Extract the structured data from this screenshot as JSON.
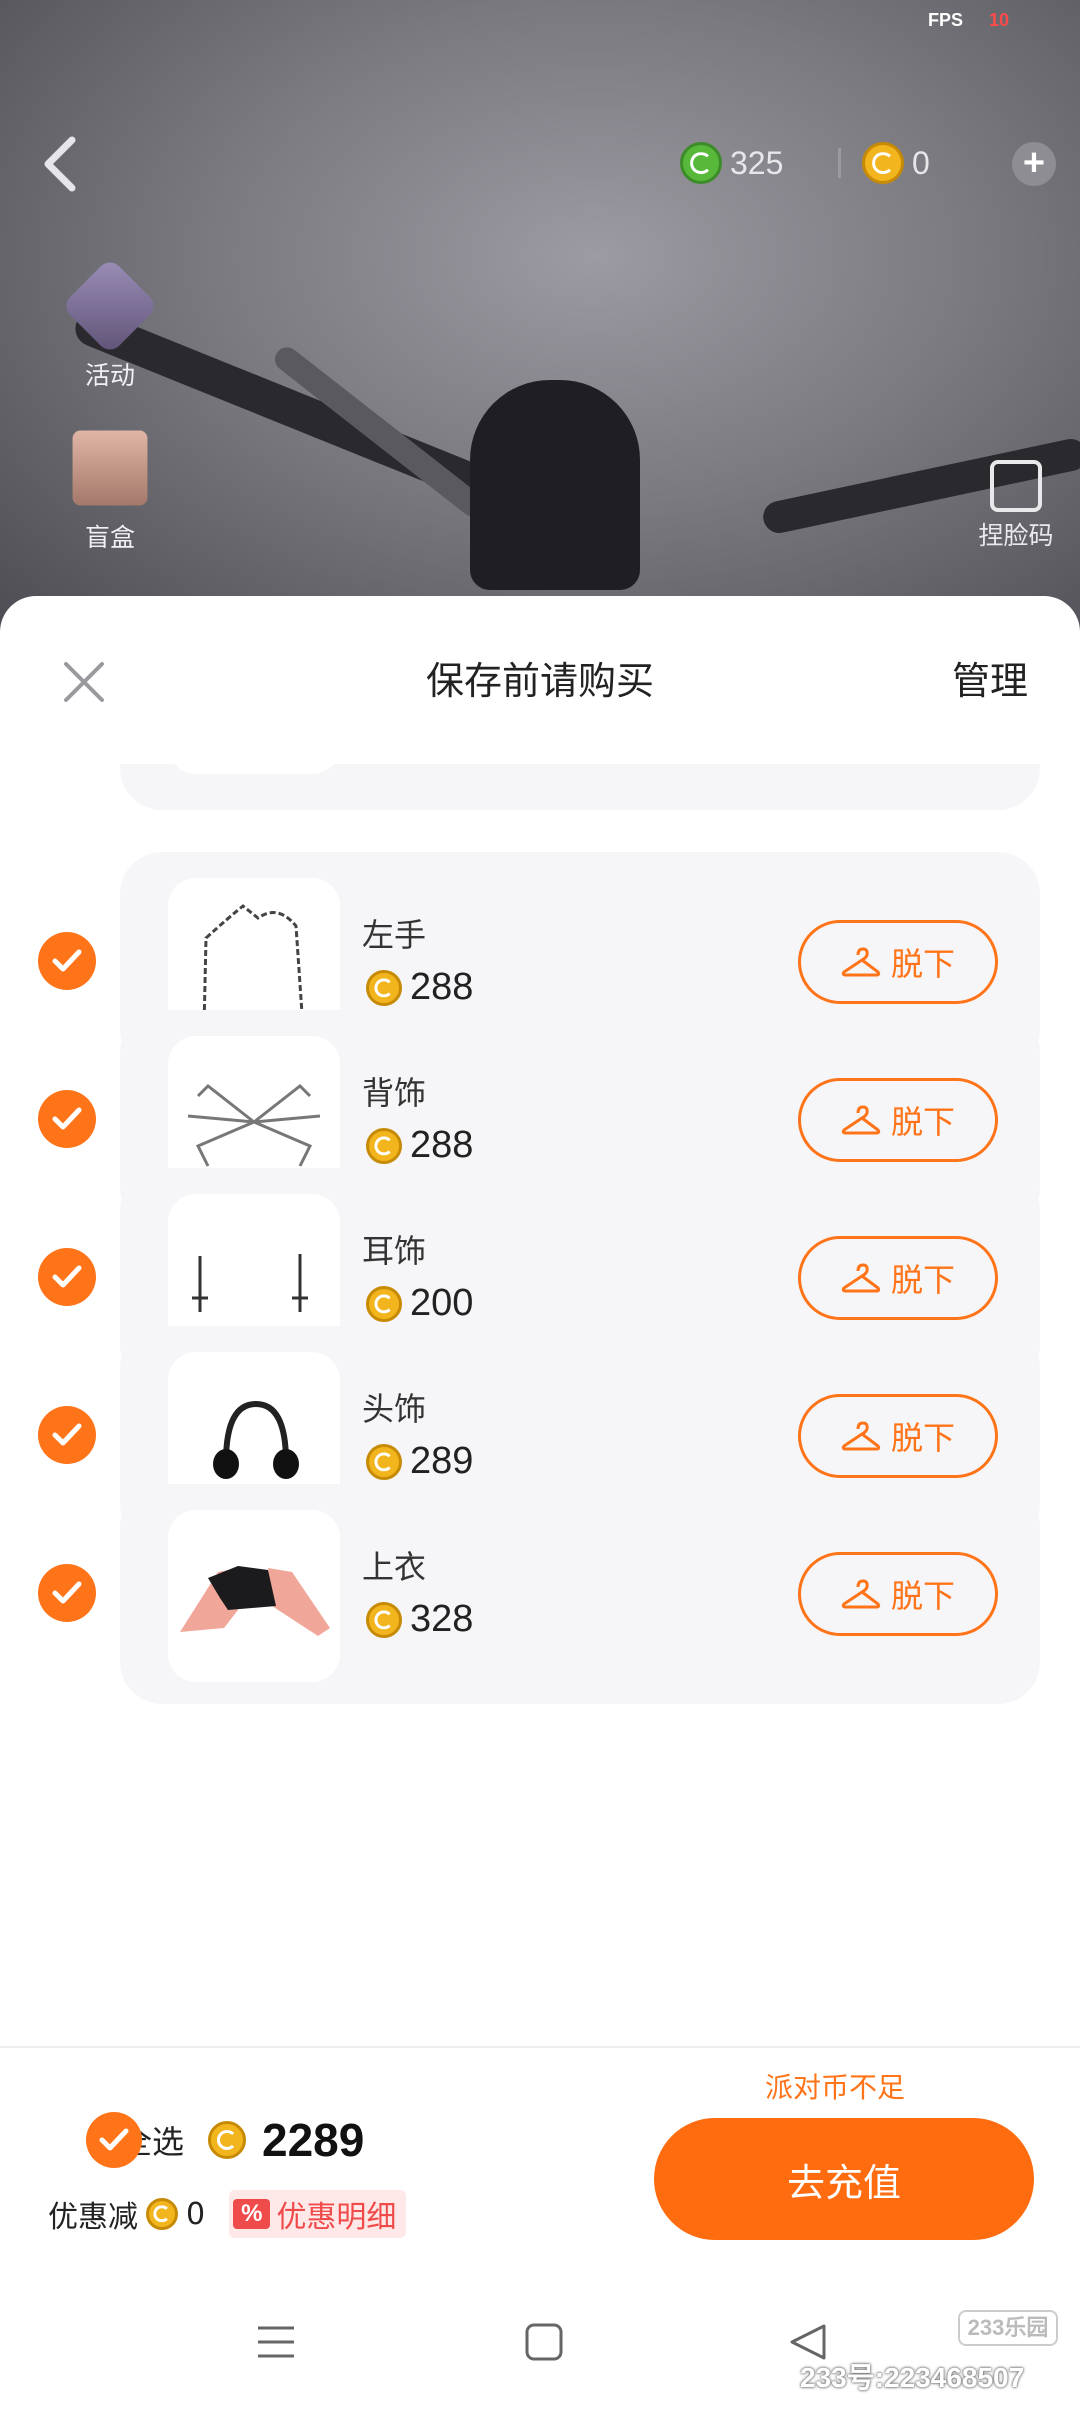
{
  "status": {
    "fps_label": "FPS",
    "fps_value": "10"
  },
  "topbar": {
    "green_coins": "325",
    "gold_coins": "0"
  },
  "side_menu": {
    "activity": "活动",
    "blind_box": "盲盒",
    "face_code": "捏脸码"
  },
  "sheet": {
    "title": "保存前请购买",
    "manage": "管理"
  },
  "items": [
    {
      "name": "左手",
      "price": "288",
      "action": "脱下"
    },
    {
      "name": "背饰",
      "price": "288",
      "action": "脱下"
    },
    {
      "name": "耳饰",
      "price": "200",
      "action": "脱下"
    },
    {
      "name": "头饰",
      "price": "289",
      "action": "脱下"
    },
    {
      "name": "上衣",
      "price": "328",
      "action": "脱下"
    }
  ],
  "footer": {
    "insufficient": "派对币不足",
    "select_all": "全选",
    "total": "2289",
    "discount_label": "优惠减",
    "discount_value": "0",
    "discount_badge": "%",
    "discount_detail": "优惠明细",
    "recharge": "去充值"
  },
  "watermark": {
    "text": "233号:223468507",
    "logo": "233乐园"
  },
  "colors": {
    "accent": "#ff7419",
    "coin_gold": "#f2b51d",
    "coin_green": "#58b83a",
    "discount_red": "#f04b4b"
  }
}
